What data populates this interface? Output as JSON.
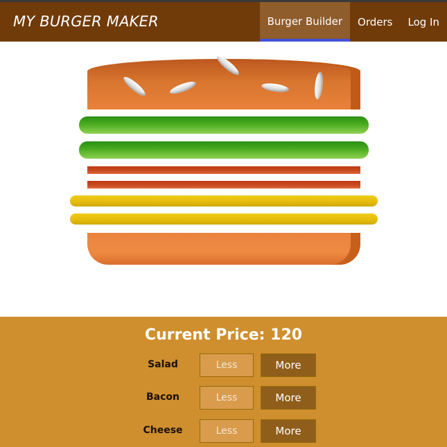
{
  "toolbar": {
    "logo_text": "MY BURGER MAKER",
    "nav": [
      {
        "label": "Burger Builder",
        "active": true
      },
      {
        "label": "Orders",
        "active": false
      },
      {
        "label": "Log In",
        "active": false
      }
    ]
  },
  "burger": {
    "ingredients": [
      "bread-top",
      "salad",
      "salad",
      "bacon",
      "bacon",
      "cheese",
      "cheese",
      "bread-bottom"
    ]
  },
  "controls": {
    "price_label": "Current Price:",
    "price_value": "120",
    "rows": [
      {
        "label": "Salad",
        "less": "Less",
        "more": "More"
      },
      {
        "label": "Bacon",
        "less": "Less",
        "more": "More"
      },
      {
        "label": "Cheese",
        "less": "Less",
        "more": "More"
      }
    ]
  },
  "colors": {
    "toolbar_bg": "#703b09",
    "active_nav_bg": "#8f5c2c",
    "active_nav_underline": "#3f51d8",
    "controls_bg": "#cf8f2e",
    "less_button_bg": "#d99c4c",
    "more_button_bg": "#8f5e1b"
  }
}
